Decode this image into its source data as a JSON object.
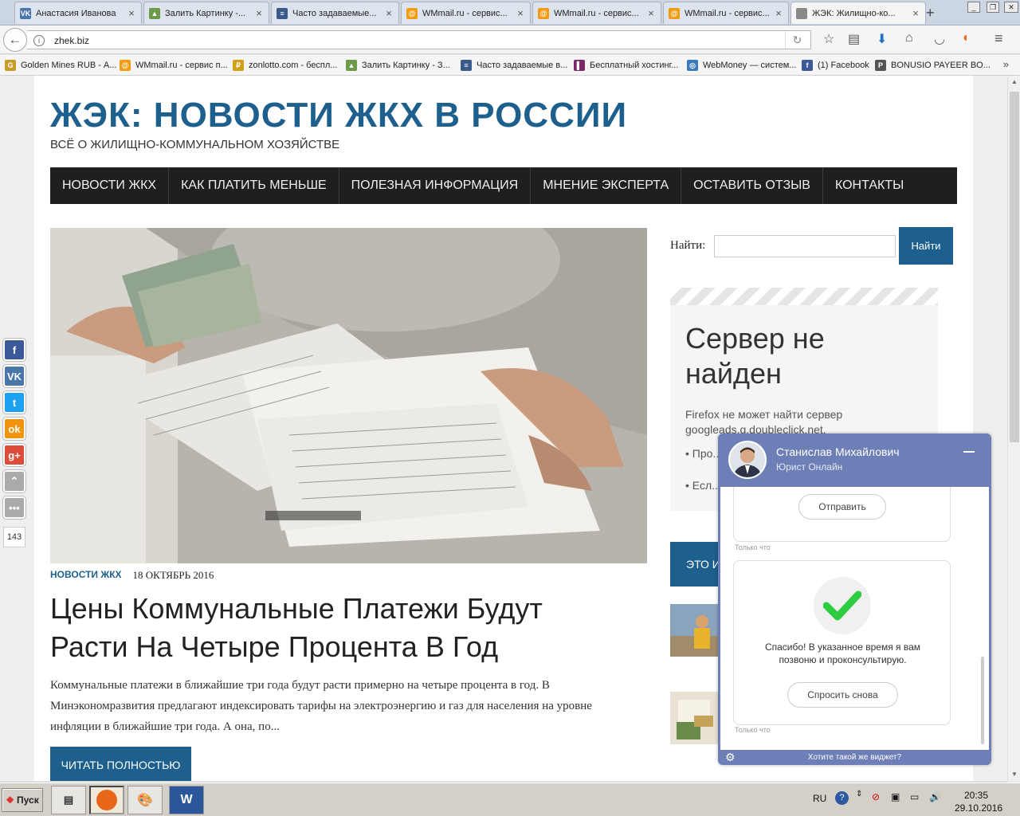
{
  "browser": {
    "tabs": [
      {
        "title": "Анастасия Иванова",
        "icon": "vk-icon",
        "color": "#4a76a8",
        "glyph": "VK"
      },
      {
        "title": "Залить Картинку -...",
        "icon": "image-icon",
        "color": "#6a9a4a",
        "glyph": "▲"
      },
      {
        "title": "Часто задаваемые...",
        "icon": "page-icon",
        "color": "#3a5a8a",
        "glyph": "≡"
      },
      {
        "title": "WMmail.ru - сервис...",
        "icon": "wmmail-icon",
        "color": "#f39c12",
        "glyph": "@"
      },
      {
        "title": "WMmail.ru - сервис...",
        "icon": "wmmail-icon",
        "color": "#f39c12",
        "glyph": "@"
      },
      {
        "title": "WMmail.ru - сервис...",
        "icon": "wmmail-icon",
        "color": "#f39c12",
        "glyph": "@"
      },
      {
        "title": "ЖЭК: Жилищно-ко...",
        "icon": "page-icon",
        "color": "#888888",
        "glyph": ""
      }
    ],
    "new_tab": "+",
    "url": "zhek.biz",
    "bookmarks": [
      {
        "label": "Golden Mines RUB - А...",
        "color": "#c89b2a",
        "glyph": "G"
      },
      {
        "label": "WMmail.ru - сервис п...",
        "color": "#f39c12",
        "glyph": "@"
      },
      {
        "label": "zonlotto.com - беспл...",
        "color": "#d4a017",
        "glyph": "₽"
      },
      {
        "label": "Залить Картинку - З...",
        "color": "#6a9a4a",
        "glyph": "▲"
      },
      {
        "label": "Часто задаваемые в...",
        "color": "#3a5a8a",
        "glyph": "≡"
      },
      {
        "label": "Бесплатный хостинг...",
        "color": "#7a2a6a",
        "glyph": "▌"
      },
      {
        "label": "WebMoney — систем...",
        "color": "#3a7ac0",
        "glyph": "◎"
      },
      {
        "label": "(1) Facebook",
        "color": "#3b5998",
        "glyph": "f"
      },
      {
        "label": "BONUSIO PAYEER BO...",
        "color": "#555555",
        "glyph": "P"
      }
    ],
    "more": "»"
  },
  "site": {
    "title": "ЖЭК: НОВОСТИ ЖКХ В РОССИИ",
    "description": "ВСЁ О ЖИЛИЩНО-КОММУНАЛЬНОМ ХОЗЯЙСТВЕ",
    "menu": [
      "НОВОСТИ ЖКХ",
      "КАК ПЛАТИТЬ МЕНЬШЕ",
      "ПОЛЕЗНАЯ ИНФОРМАЦИЯ",
      "МНЕНИЕ ЭКСПЕРТА",
      "ОСТАВИТЬ ОТЗЫВ",
      "КОНТАКТЫ"
    ],
    "accent": "#1d5f8d"
  },
  "article": {
    "category": "НОВОСТИ ЖКХ",
    "date": "18 ОКТЯБРЬ 2016",
    "headline": "Цены Коммунальные Платежи Будут Расти На Четыре Процента В Год",
    "excerpt": "Коммунальные платежи в ближайшие три года будут расти примерно на четыре процента в год. В Минэкономразвития предлагают индексировать тарифы на электроэнергию и газ для населения на уровне инфляции в ближайшие три года. А она, по...",
    "read_more": "ЧИТАТЬ ПОЛНОСТЬЮ"
  },
  "sidebar": {
    "search_label": "Найти:",
    "search_value": "",
    "search_button": "Найти",
    "error_title": "Сервер не найден",
    "error_text": "Firefox не может найти сервер googleads.g.doubleclick.net.",
    "error_items": [
      "Про... наб... вме...",
      "Есл..."
    ],
    "blue_box": "ЭТО И"
  },
  "share": {
    "buttons": [
      {
        "name": "facebook-share-icon",
        "glyph": "f",
        "color": "#3b5998"
      },
      {
        "name": "vk-share-icon",
        "glyph": "VK",
        "color": "#4a76a8"
      },
      {
        "name": "twitter-share-icon",
        "glyph": "t",
        "color": "#1da1f2"
      },
      {
        "name": "odnoklassniki-share-icon",
        "glyph": "ok",
        "color": "#f2930c"
      },
      {
        "name": "googleplus-share-icon",
        "glyph": "g+",
        "color": "#dd4b39"
      },
      {
        "name": "scroll-up-icon",
        "glyph": "⌃",
        "color": "#aaaaaa"
      },
      {
        "name": "more-icon",
        "glyph": "•••",
        "color": "#aaaaaa"
      }
    ],
    "count": "143"
  },
  "chat": {
    "agent_name": "Станислав Михайлович",
    "agent_role": "Юрист Онлайн",
    "send_label": "Отправить",
    "time1": "Только что",
    "thanks": "Спасибо! В указанное время я вам позвоню и проконсультирую.",
    "ask_again": "Спросить снова",
    "time2": "Только что",
    "footer": "Хотите такой же виджет?"
  },
  "taskbar": {
    "start": "Пуск",
    "lang": "RU",
    "time": "20:35",
    "date": "29.10.2016"
  }
}
